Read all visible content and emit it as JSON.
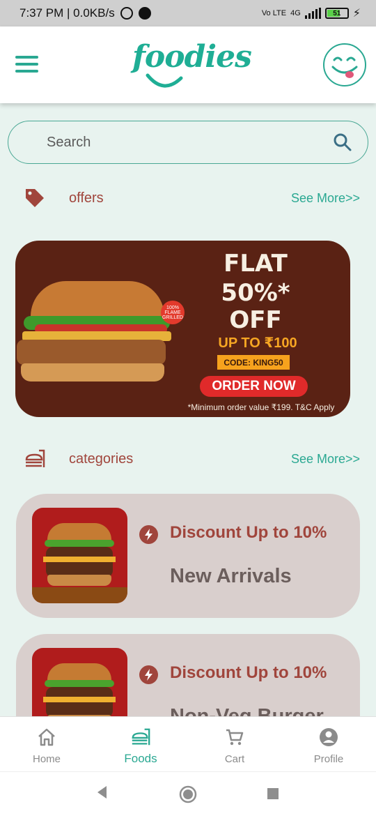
{
  "status_bar": {
    "time_speed": "7:37 PM | 0.0KB/s",
    "network": "Vo LTE",
    "signal": "4G",
    "battery": "51"
  },
  "header": {
    "logo_text": "foodies",
    "icons": {
      "menu": "hamburger-menu-icon",
      "profile": "smiley-tongue-face-icon"
    }
  },
  "search": {
    "placeholder": "Search",
    "icon": "search-icon"
  },
  "offers": {
    "title": "offers",
    "see_more": "See More>>",
    "icon": "tag-icon",
    "banner": {
      "headline_line1": "FLAT",
      "headline_line2": "50%*",
      "headline_line3": "OFF",
      "up_to": "UP TO ₹100",
      "code": "CODE: KING50",
      "cta": "ORDER NOW",
      "fine_print": "*Minimum order value ₹199. T&C Apply",
      "badge": "100% FLAME GRILLED"
    }
  },
  "categories": {
    "title": "categories",
    "see_more": "See More>>",
    "icon": "food-tray-icon",
    "items": [
      {
        "discount": "Discount Up to 10%",
        "name": "New Arrivals"
      },
      {
        "discount": "Discount Up to 10%",
        "name": "Non-Veg Burger"
      }
    ]
  },
  "bottom_nav": {
    "items": [
      {
        "label": "Home",
        "icon": "home-icon",
        "active": false
      },
      {
        "label": "Foods",
        "icon": "food-tray-icon",
        "active": true
      },
      {
        "label": "Cart",
        "icon": "cart-icon",
        "active": false
      },
      {
        "label": "Profile",
        "icon": "account-circle-icon",
        "active": false
      }
    ]
  },
  "colors": {
    "brand_teal": "#2aa892",
    "accent_maroon": "#a0453c",
    "background": "#e8f3ef",
    "card_bg": "#d9cfcd"
  }
}
